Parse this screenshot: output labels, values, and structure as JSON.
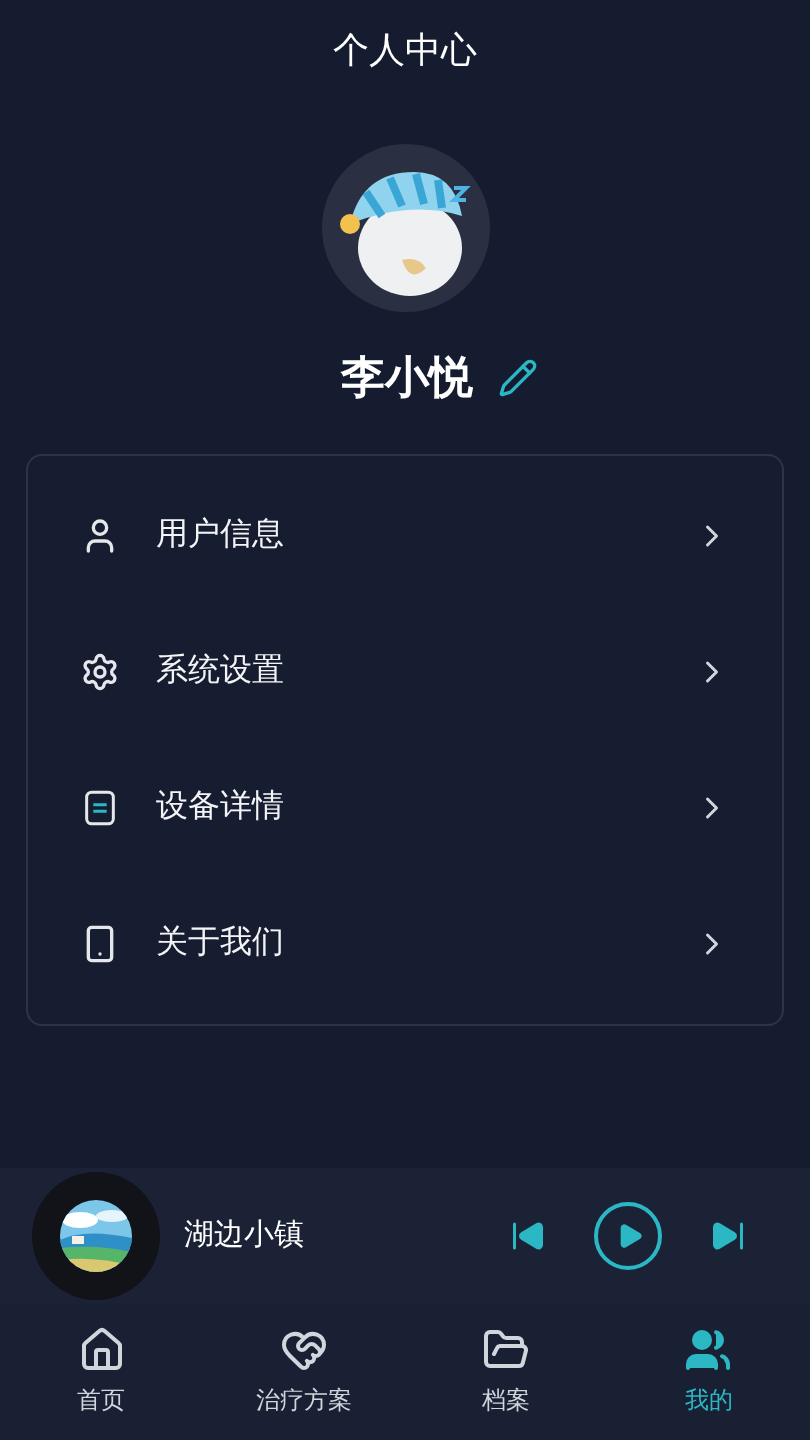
{
  "header": {
    "title": "个人中心"
  },
  "profile": {
    "name": "李小悦"
  },
  "menu": [
    {
      "kind": "user",
      "label": "用户信息"
    },
    {
      "kind": "settings",
      "label": "系统设置"
    },
    {
      "kind": "device",
      "label": "设备详情"
    },
    {
      "kind": "about",
      "label": "关于我们"
    }
  ],
  "player": {
    "track": "湖边小镇",
    "playing": false
  },
  "tabs": [
    {
      "kind": "home",
      "label": "首页",
      "selected": false
    },
    {
      "kind": "plan",
      "label": "治疗方案",
      "selected": false
    },
    {
      "kind": "archive",
      "label": "档案",
      "selected": false
    },
    {
      "kind": "mine",
      "label": "我的",
      "selected": true
    }
  ]
}
